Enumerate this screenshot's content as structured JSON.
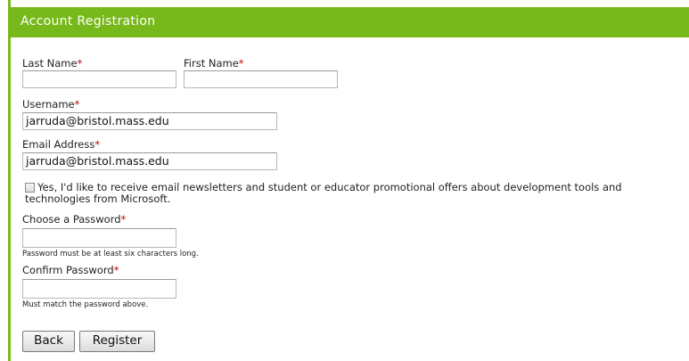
{
  "header": {
    "title": "Account Registration"
  },
  "required_marker": "*",
  "form": {
    "last_name": {
      "label": "Last Name",
      "value": ""
    },
    "first_name": {
      "label": "First Name",
      "value": ""
    },
    "username": {
      "label": "Username",
      "value": "jarruda@bristol.mass.edu"
    },
    "email": {
      "label": "Email Address",
      "value": "jarruda@bristol.mass.edu"
    },
    "newsletter": {
      "checked": false,
      "text": "Yes, I'd like to receive email newsletters and student or educator promotional offers about development tools and technologies from Microsoft."
    },
    "password": {
      "label": "Choose a Password",
      "value": "",
      "hint": "Password must be at least six characters long."
    },
    "confirm_password": {
      "label": "Confirm Password",
      "value": "",
      "hint": "Must match the password above."
    }
  },
  "buttons": {
    "back": "Back",
    "register": "Register"
  },
  "colors": {
    "header_bg": "#77b81b",
    "required": "#cc0000"
  }
}
